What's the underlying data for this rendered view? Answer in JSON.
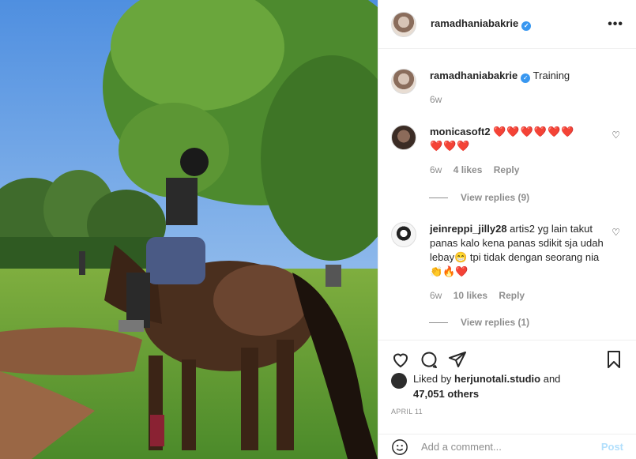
{
  "post": {
    "username": "ramadhaniabakrie",
    "more_icon": "•••"
  },
  "caption": {
    "username": "ramadhaniabakrie",
    "text": "Training",
    "time": "6w"
  },
  "comments": [
    {
      "username": "monicasoft2",
      "text_hearts_line1": "❤️❤️❤️❤️❤️❤️",
      "text_hearts_line2": "❤️❤️❤️",
      "time": "6w",
      "likes": "4 likes",
      "reply": "Reply",
      "view_replies": "View replies (9)"
    },
    {
      "username": "jeinreppi_jilly28",
      "text": "artis2 yg lain takut panas kalo kena panas sdikit sja udah lebay😁 tpi tidak dengan seorang nia👏🔥❤️",
      "time": "6w",
      "likes": "10 likes",
      "reply": "Reply",
      "view_replies": "View replies (1)"
    }
  ],
  "liked_by": {
    "prefix": "Liked by ",
    "user": "herjunotali.studio",
    "middle": " and",
    "count": "47,051 others"
  },
  "date": "APRIL 11",
  "add_comment": {
    "placeholder": "Add a comment...",
    "post_label": "Post"
  },
  "icons": {
    "verified": "verified-badge-icon",
    "like": "heart-icon",
    "comment": "comment-icon",
    "share": "paper-plane-icon",
    "save": "bookmark-icon",
    "emoji": "smiley-icon"
  },
  "colors": {
    "verified": "#3897f0",
    "heart": "#ed4956",
    "muted": "#8e8e8e",
    "post_disabled": "#b2dffc"
  }
}
